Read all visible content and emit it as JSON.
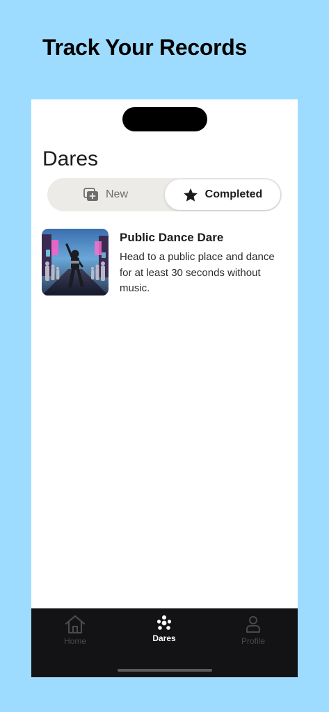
{
  "headline": "Track Your Records",
  "screen": {
    "title": "Dares",
    "segments": [
      {
        "label": "New",
        "icon": "stack-plus-icon",
        "selected": false
      },
      {
        "label": "Completed",
        "icon": "star-icon",
        "selected": true
      }
    ]
  },
  "dares": [
    {
      "title": "Public Dance Dare",
      "description": "Head to a public place and dance for at least 30 seconds without music.",
      "image": "dance-street-photo"
    }
  ],
  "tabbar": {
    "items": [
      {
        "label": "Home",
        "icon": "house-icon",
        "active": false
      },
      {
        "label": "Dares",
        "icon": "people-group-icon",
        "active": true
      },
      {
        "label": "Profile",
        "icon": "person-icon",
        "active": false
      }
    ]
  },
  "colors": {
    "background": "#9edcff",
    "tabbar": "#131316",
    "segment_track": "#ecebe7"
  }
}
